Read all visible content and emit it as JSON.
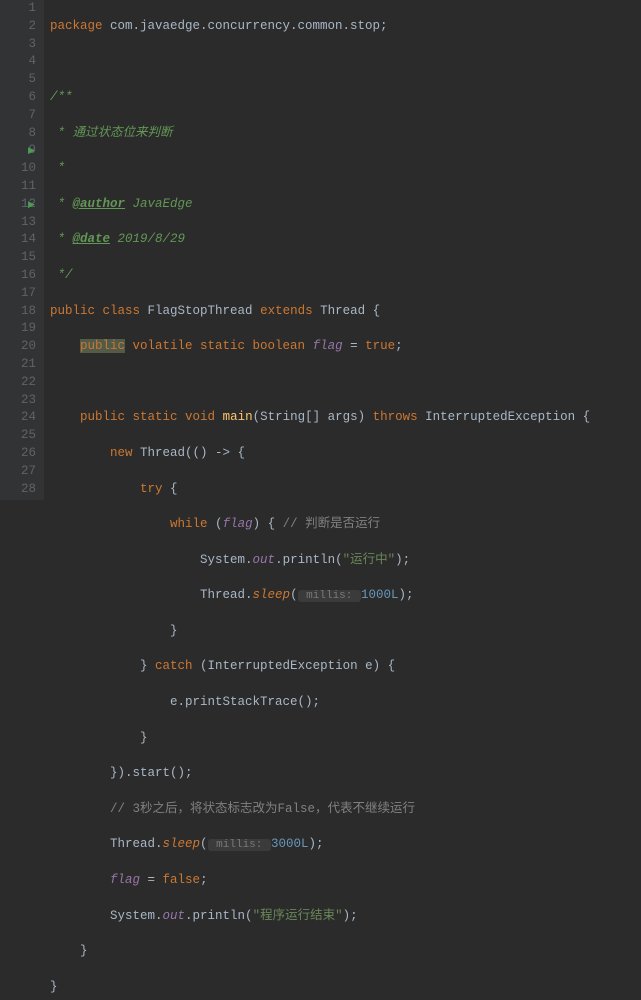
{
  "lines": {
    "l1_kw": "package",
    "l1_pkg": " com.javaedge.concurrency.common.stop;",
    "l3": "/**",
    "l4": " * 通过状态位来判断",
    "l5": " *",
    "l6_a": " * ",
    "l6_tag": "@author",
    "l6_b": " JavaEdge",
    "l7_a": " * ",
    "l7_tag": "@date",
    "l7_b": " 2019/8/29",
    "l8": " */",
    "l9_a": "public class ",
    "l9_cls": "FlagStopThread",
    "l9_b": " extends ",
    "l9_sup": "Thread",
    "l9_c": " {",
    "l10_a": "public",
    "l10_b": " volatile static boolean ",
    "l10_f": "flag",
    "l10_c": " = ",
    "l10_v": "true",
    "l10_d": ";",
    "l12_a": "public static ",
    "l12_ret": "void ",
    "l12_m": "main",
    "l12_b": "(String[] args) ",
    "l12_c": "throws ",
    "l12_ex": "InterruptedException",
    "l12_d": " {",
    "l13_a": "new ",
    "l13_cls": "Thread",
    "l13_b": "(() -> {",
    "l14_a": "try ",
    "l14_b": "{",
    "l15_a": "while ",
    "l15_b": "(",
    "l15_f": "flag",
    "l15_c": ") { ",
    "l15_cmt": "// 判断是否运行",
    "l16_a": "System.",
    "l16_out": "out",
    "l16_b": ".println(",
    "l16_s": "\"运行中\"",
    "l16_c": ");",
    "l17_a": "Thread.",
    "l17_m": "sleep",
    "l17_b": "(",
    "l17_hint": " millis: ",
    "l17_n": "1000L",
    "l17_c": ");",
    "l18": "}",
    "l19_a": "} ",
    "l19_b": "catch ",
    "l19_c": "(InterruptedException e) {",
    "l20_a": "e.printStackTrace();",
    "l21": "}",
    "l22": "}).start();",
    "l23": "// 3秒之后，将状态标志改为False，代表不继续运行",
    "l24_a": "Thread.",
    "l24_m": "sleep",
    "l24_b": "(",
    "l24_hint": " millis: ",
    "l24_n": "3000L",
    "l24_c": ");",
    "l25_a": "flag",
    "l25_b": " = ",
    "l25_v": "false",
    "l25_c": ";",
    "l26_a": "System.",
    "l26_out": "out",
    "l26_b": ".println(",
    "l26_s": "\"程序运行结束\"",
    "l26_c": ");",
    "l27": "}",
    "l28": "}"
  },
  "numbers": [
    "1",
    "2",
    "3",
    "4",
    "5",
    "6",
    "7",
    "8",
    "9",
    "10",
    "11",
    "12",
    "13",
    "14",
    "15",
    "16",
    "17",
    "18",
    "19",
    "20",
    "21",
    "22",
    "23",
    "24",
    "25",
    "26",
    "27",
    "28"
  ]
}
